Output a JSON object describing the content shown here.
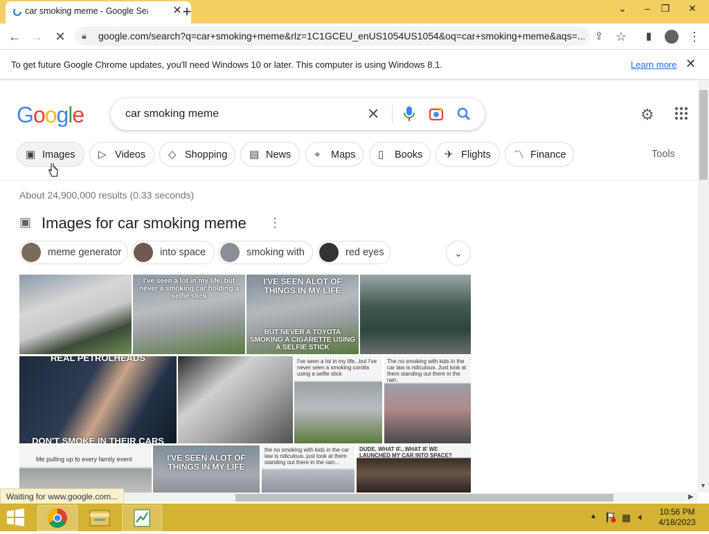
{
  "browser": {
    "tab_title": "car smoking meme - Google Sea",
    "url": "google.com/search?q=car+smoking+meme&rlz=1C1GCEU_enUS1054US1054&oq=car+smoking+meme&aqs=...",
    "infobar_text": "To get future Google Chrome updates, you'll need Windows 10 or later. This computer is using Windows 8.1.",
    "infobar_link": "Learn more",
    "status_text": "Waiting for www.google.com..."
  },
  "search": {
    "logo": "Google",
    "query": "car smoking meme",
    "tabs": [
      {
        "label": "Images",
        "icon": "image-icon"
      },
      {
        "label": "Videos",
        "icon": "play-icon"
      },
      {
        "label": "Shopping",
        "icon": "tag-icon"
      },
      {
        "label": "News",
        "icon": "news-icon"
      },
      {
        "label": "Maps",
        "icon": "pin-icon"
      },
      {
        "label": "Books",
        "icon": "book-icon"
      },
      {
        "label": "Flights",
        "icon": "plane-icon"
      },
      {
        "label": "Finance",
        "icon": "chart-icon"
      }
    ],
    "tools_label": "Tools",
    "results_count": "About 24,900,000 results (0.33 seconds)"
  },
  "images_section": {
    "title": "Images for car smoking meme",
    "related": [
      "meme generator",
      "into space",
      "smoking with",
      "red eyes"
    ],
    "captions": {
      "c1": "I've seen a lot in my life, but never a smoking car holding a selfie stick",
      "c2a": "I'VE SEEN ALOT OF THINGS IN MY LIFE",
      "c2b": "BUT NEVER A TOYOTA SMOKING A CIGARETTE USING A SELFIE STICK",
      "c3a": "REAL PETROLHEADS",
      "c3b": "DON'T SMOKE IN THEIR CARS",
      "c4": "I've seen a lot in my life...but I've never seen a smoking corolla using a selfie stick",
      "c5": "The no smoking with kids in the car law is ridiculous. Just look at them standing out there in the rain.",
      "c6": "Me pulling up to every family event",
      "c7": "I'VE SEEN ALOT OF THINGS IN MY LIFE",
      "c8": "the no smoking with kids in the car law is ridiculous..just look at them standing out there in the rain...",
      "c9": "DUDE, WHAT IF...WHAT IF WE LAUNCHED MY CAR INTO SPACE?"
    }
  },
  "taskbar": {
    "time": "10:56 PM",
    "date": "4/18/2023"
  },
  "colors": {
    "tabstrip": "#f3cf63",
    "taskbar": "#d4b233",
    "link": "#1a73e8"
  }
}
